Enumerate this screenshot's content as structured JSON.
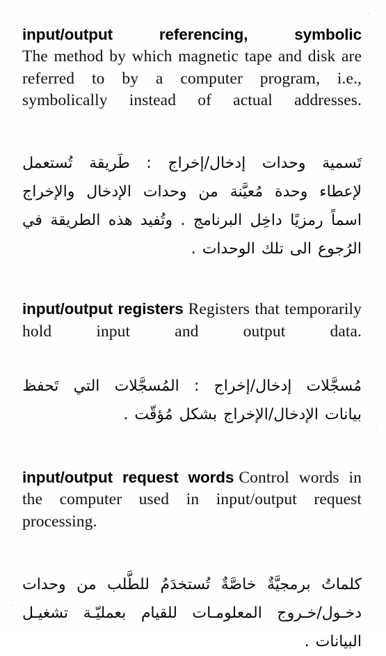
{
  "page": {
    "kind": "scanned-dictionary-page",
    "background_color": "#fefefe",
    "text_color": "#0d0d0d",
    "languages": [
      "English",
      "Arabic"
    ]
  },
  "entries": [
    {
      "id": "input-output-referencing-symbolic",
      "headword": "input/output referencing, symbolic",
      "headword_words": [
        "input/output",
        "referencing,",
        "symbolic"
      ],
      "headword_own_line": true,
      "english_definition": "The method by which magnetic tape and disk are referred to by a computer program, i.e., symbolically instead of actual addresses.",
      "arabic_lines": [
        "تَسمية وحدات إدخال/إخراج : طَريقة تُستعمل",
        "لإعطاء وحدة مُعيَّنة من وحدات الإدخال والإخراج",
        "اسماً رمزيًا داخِل البرنامج . وتُفيد هذه الطريقة في",
        "الرُجوع الى تلك الوحدات ."
      ]
    },
    {
      "id": "input-output-registers",
      "headword": "input/output registers",
      "headword_own_line": false,
      "english_definition": "Registers that temporarily hold input and output data.",
      "arabic_lines": [
        "مُسجَّلات إدخال/إخراج : المُسجَّلات التي تَحفظ",
        "بيانات الإدخال/الإخراج بشكل مُؤقّت ."
      ]
    },
    {
      "id": "input-output-request-words",
      "headword": "input/output request words",
      "headword_own_line": false,
      "english_definition": "Control words in the computer used in input/output request processing.",
      "arabic_lines": [
        "كلماتُ برمجيَّةٌ خاصَّةٌ تُستخدَمُ للطَّلب من وحدات",
        "دخـول/خـروج المعلومـات للقيام بعمليّـة تشغيـل",
        "البيانات ."
      ]
    }
  ]
}
